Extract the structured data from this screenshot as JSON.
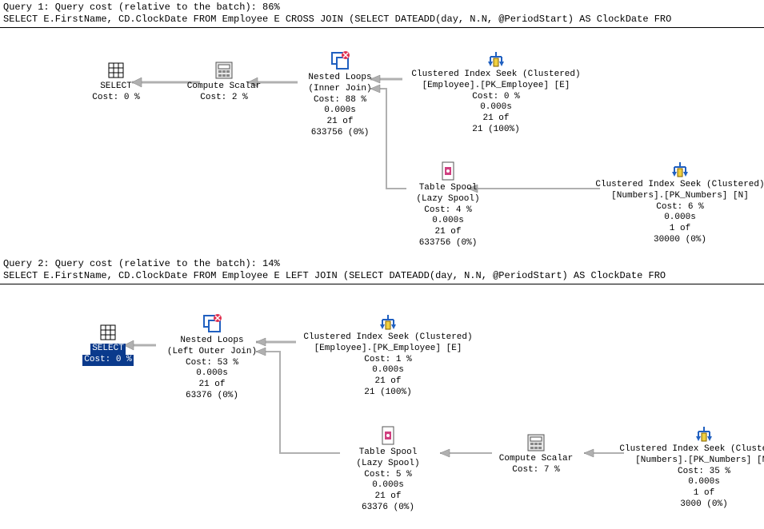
{
  "query1": {
    "header": "Query 1: Query cost (relative to the batch): 86%",
    "sql": "SELECT E.FirstName, CD.ClockDate FROM Employee E CROSS JOIN (SELECT DATEADD(day, N.N, @PeriodStart) AS ClockDate FRO",
    "ops": {
      "select": {
        "title": "SELECT",
        "cost": "Cost: 0 %"
      },
      "compute": {
        "title": "Compute Scalar",
        "cost": "Cost: 2 %"
      },
      "nested": {
        "title": "Nested Loops",
        "sub": "(Inner Join)",
        "cost": "Cost: 88 %",
        "time": "0.000s",
        "rows1": "21 of",
        "rows2": "633756 (0%)"
      },
      "seekEmp": {
        "title": "Clustered Index Seek (Clustered)",
        "sub": "[Employee].[PK_Employee] [E]",
        "cost": "Cost: 0 %",
        "time": "0.000s",
        "rows1": "21 of",
        "rows2": "21 (100%)"
      },
      "spool": {
        "title": "Table Spool",
        "sub": "(Lazy Spool)",
        "cost": "Cost: 4 %",
        "time": "0.000s",
        "rows1": "21 of",
        "rows2": "633756 (0%)"
      },
      "seekNum": {
        "title": "Clustered Index Seek (Clustered)",
        "sub": "[Numbers].[PK_Numbers] [N]",
        "cost": "Cost: 6 %",
        "time": "0.000s",
        "rows1": "1 of",
        "rows2": "30000 (0%)"
      }
    }
  },
  "query2": {
    "header": "Query 2: Query cost (relative to the batch): 14%",
    "sql": "SELECT E.FirstName, CD.ClockDate FROM Employee E LEFT JOIN (SELECT DATEADD(day, N.N, @PeriodStart) AS ClockDate FRO",
    "ops": {
      "select": {
        "title": "SELECT",
        "cost": "Cost: 0 %"
      },
      "nested": {
        "title": "Nested Loops",
        "sub": "(Left Outer Join)",
        "cost": "Cost: 53 %",
        "time": "0.000s",
        "rows1": "21 of",
        "rows2": "63376 (0%)"
      },
      "seekEmp": {
        "title": "Clustered Index Seek (Clustered)",
        "sub": "[Employee].[PK_Employee] [E]",
        "cost": "Cost: 1 %",
        "time": "0.000s",
        "rows1": "21 of",
        "rows2": "21 (100%)"
      },
      "spool": {
        "title": "Table Spool",
        "sub": "(Lazy Spool)",
        "cost": "Cost: 5 %",
        "time": "0.000s",
        "rows1": "21 of",
        "rows2": "63376 (0%)"
      },
      "compute": {
        "title": "Compute Scalar",
        "cost": "Cost: 7 %"
      },
      "seekNum": {
        "title": "Clustered Index Seek (Clustered)",
        "sub": "[Numbers].[PK_Numbers] [N]",
        "cost": "Cost: 35 %",
        "time": "0.000s",
        "rows1": "1 of",
        "rows2": "3000 (0%)"
      }
    }
  }
}
